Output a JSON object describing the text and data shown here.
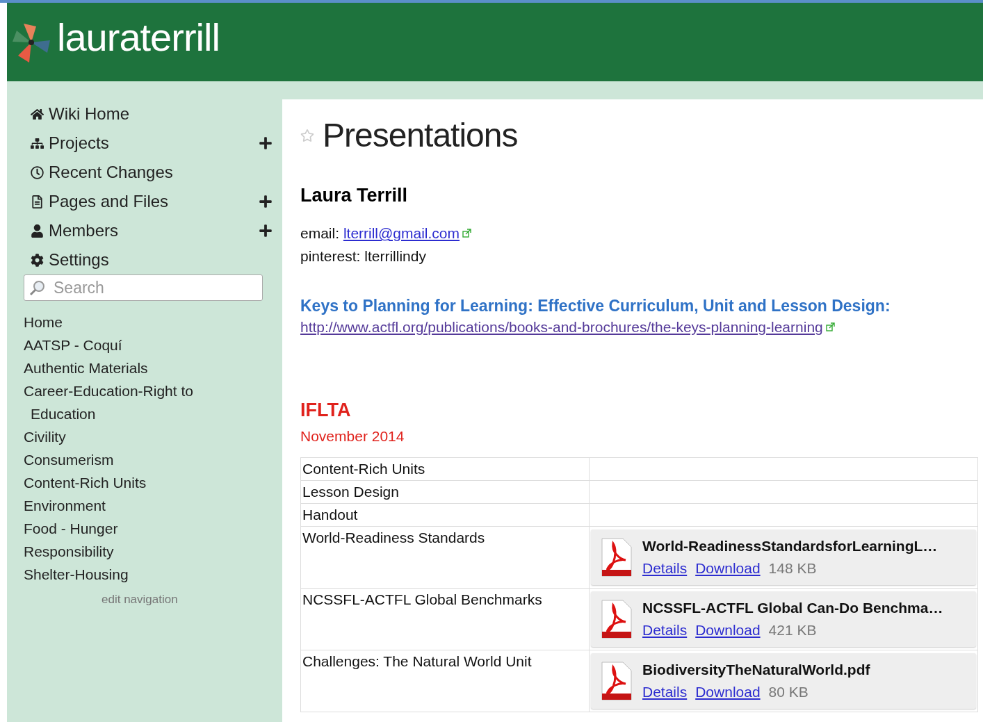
{
  "header": {
    "site_name": "lauraterrill"
  },
  "nav": [
    {
      "label": "Wiki Home",
      "expandable": false
    },
    {
      "label": "Projects",
      "expandable": true
    },
    {
      "label": "Recent Changes",
      "expandable": false
    },
    {
      "label": "Pages and Files",
      "expandable": true
    },
    {
      "label": "Members",
      "expandable": true
    },
    {
      "label": "Settings",
      "expandable": false
    }
  ],
  "search": {
    "placeholder": "Search"
  },
  "links": [
    "Home",
    "AATSP - Coquí",
    "Authentic Materials",
    "Career-Education-Right to Education",
    "Civility",
    "Consumerism",
    "Content-Rich Units",
    "Environment",
    "Food - Hunger",
    "Responsibility",
    "Shelter-Housing"
  ],
  "edit_navigation": "edit navigation",
  "page": {
    "title": "Presentations",
    "author": "Laura Terrill",
    "email_label": "email:",
    "email": "lterrill@gmail.com",
    "pinterest": "pinterest: lterrillindy",
    "book_title": "Keys to Planning for Learning: Effective Curriculum, Unit and Lesson Design:",
    "book_url": "http://www.actfl.org/publications/books-and-brochures/the-keys-planning-learning",
    "section_title": "IFLTA",
    "section_date": "November 2014"
  },
  "table": {
    "rows": [
      {
        "label": "Content-Rich Units"
      },
      {
        "label": "Lesson Design"
      },
      {
        "label": "Handout"
      },
      {
        "label": "World-Readiness Standards",
        "file": {
          "name": "World-ReadinessStandardsforLearningL…",
          "details": "Details",
          "download": "Download",
          "size": "148 KB"
        }
      },
      {
        "label": "NCSSFL-ACTFL Global Benchmarks",
        "file": {
          "name": "NCSSFL-ACTFL Global Can-Do Benchma…",
          "details": "Details",
          "download": "Download",
          "size": "421 KB"
        }
      },
      {
        "label": "Challenges: The Natural World Unit",
        "file": {
          "name": "BiodiversityTheNaturalWorld.pdf",
          "details": "Details",
          "download": "Download",
          "size": "80 KB"
        }
      }
    ]
  }
}
